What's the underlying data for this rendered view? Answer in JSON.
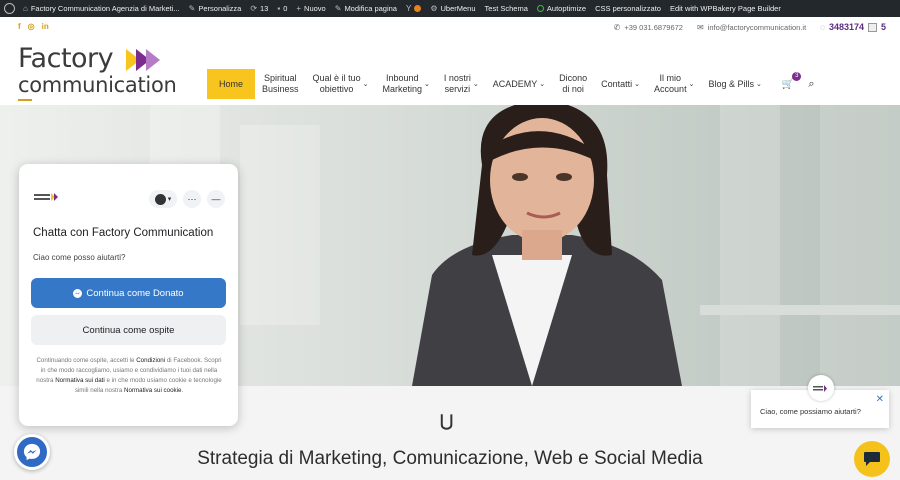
{
  "adminbar": {
    "site_name": "Factory Communication Agenzia di Marketi...",
    "customize": "Personalizza",
    "updates": "13",
    "comments": "0",
    "new": "Nuovo",
    "edit_page": "Modifica pagina",
    "ubermenu": "UberMenu",
    "test_schema": "Test Schema",
    "autoptimize": "Autoptimize",
    "custom_css": "CSS personalizzato",
    "wpbakery": "Edit with WPBakery Page Builder"
  },
  "topbar": {
    "social": [
      "f",
      "◎",
      "in"
    ],
    "phone": "+39 031.6879672",
    "email": "info@factorycommunication.it",
    "whatsapp": "3483174",
    "whatsapp_suffix": "5"
  },
  "logo": {
    "line1": "Factory",
    "line2": "communication"
  },
  "nav": {
    "home": "Home",
    "spiritual_1": "Spiritual",
    "spiritual_2": "Business",
    "obiettivo_1": "Qual è il tuo",
    "obiettivo_2": "obiettivo",
    "inbound_1": "Inbound",
    "inbound_2": "Marketing",
    "servizi_1": "I nostri",
    "servizi_2": "servizi",
    "academy": "ACADEMY",
    "dicono_1": "Dicono",
    "dicono_2": "di noi",
    "contatti": "Contatti",
    "account_1": "Il mio",
    "account_2": "Account",
    "blog": "Blog & Pills",
    "cart_count": "3"
  },
  "section": {
    "headline": "Strategia di Marketing, Comunicazione, Web e Social Media"
  },
  "chat": {
    "title": "Chatta con Factory Communication",
    "greeting": "Ciao come posso aiutarti?",
    "continue_as": "Continua come Donato",
    "continue_guest": "Continua come ospite",
    "legal_1": "Continuando come ospite, accetti le ",
    "legal_terms": "Condizioni",
    "legal_2": " di Facebook. Scopri in che modo raccogliamo, usiamo e condividiamo i tuoi dati nella nostra ",
    "legal_data": "Normativa sui dati",
    "legal_3": " e in che modo usiamo cookie e tecnologie simili nella nostra ",
    "legal_cookie": "Normativa sui cookie",
    "legal_4": "."
  },
  "tooltip": {
    "text": "Ciao, come possiamo aiutarti?"
  },
  "colors": {
    "brand_yellow": "#f7c51e",
    "brand_purple": "#7b2d8e",
    "messenger_blue": "#3578c8",
    "adminbar": "#23282d"
  }
}
